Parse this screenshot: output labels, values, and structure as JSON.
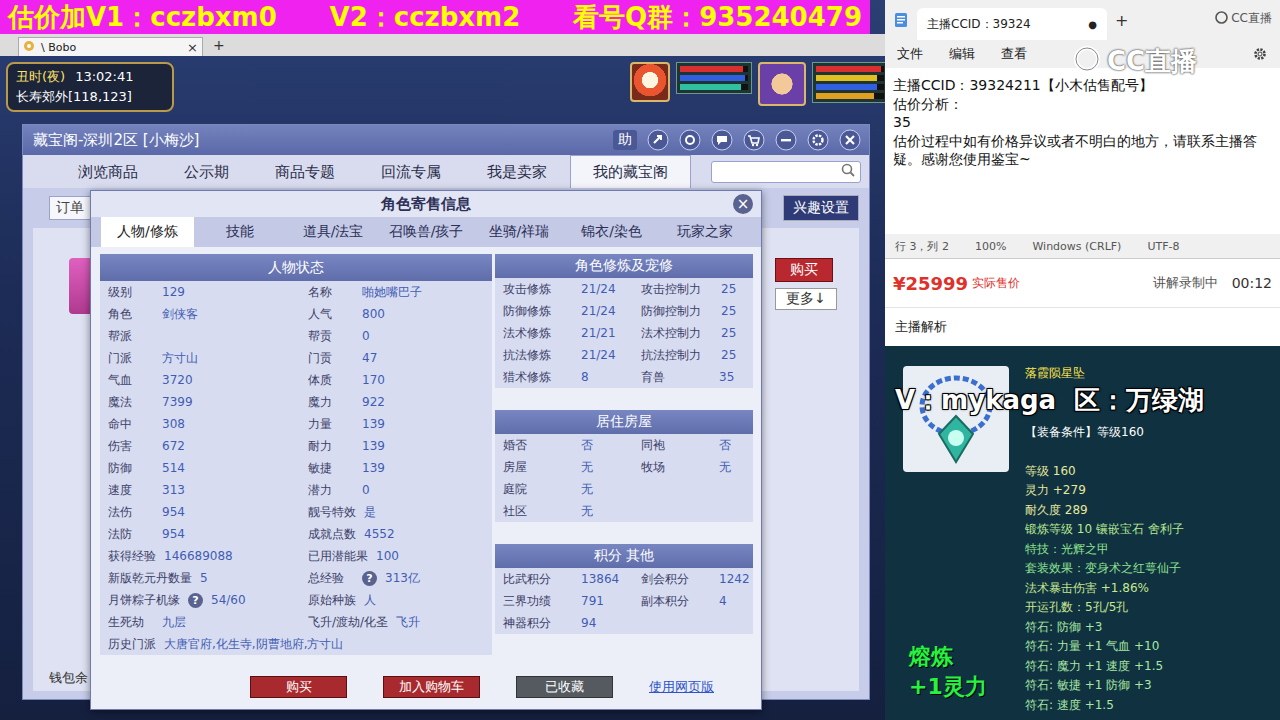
{
  "banner": {
    "parts": [
      "估价加V1：cczbxm0",
      "V2：cczbxm2",
      "看号Q群：935240479"
    ]
  },
  "browser_tab": {
    "label": "\\ Bobo",
    "close": "×",
    "new": "+"
  },
  "hud": {
    "time": "丑时(夜)",
    "clock": "13:02:41",
    "location": "长寿郊外[118,123]",
    "pet_bars": [
      {
        "level": 0.92,
        "color": "#d83030"
      },
      {
        "level": 0.95,
        "color": "#3060e0"
      },
      {
        "level": 0.9,
        "color": "#30c0a0"
      }
    ],
    "player_bars": [
      {
        "level": 0.95,
        "color": "#d83030"
      },
      {
        "level": 0.9,
        "color": "#e0c020"
      },
      {
        "level": 0.9,
        "color": "#3060e0"
      },
      {
        "level": 0.85,
        "color": "#e0a020"
      }
    ]
  },
  "cbg": {
    "title": "藏宝阁-深圳2区 [小梅沙]",
    "help": "助",
    "tabs": [
      {
        "label": "浏览商品",
        "selected": false
      },
      {
        "label": "公示期",
        "selected": false
      },
      {
        "label": "商品专题",
        "selected": false
      },
      {
        "label": "回流专属",
        "selected": false
      },
      {
        "label": "我是卖家",
        "selected": false
      },
      {
        "label": "我的藏宝阁",
        "selected": true
      }
    ],
    "order_label": "订单",
    "interest_button": "兴趣设置",
    "buy_button": "购买",
    "more_button": "更多↓",
    "wallet": "钱包余"
  },
  "dialog": {
    "title": "角色寄售信息",
    "close": "×",
    "tabs": [
      {
        "label": "人物/修炼",
        "selected": true
      },
      {
        "label": "技能",
        "selected": false
      },
      {
        "label": "道具/法宝",
        "selected": false
      },
      {
        "label": "召唤兽/孩子",
        "selected": false
      },
      {
        "label": "坐骑/祥瑞",
        "selected": false
      },
      {
        "label": "锦衣/染色",
        "selected": false
      },
      {
        "label": "玩家之家",
        "selected": false
      }
    ],
    "status_title": "人物状态",
    "status_rows": [
      [
        {
          "label": "级别",
          "value": "129"
        },
        {
          "label": "名称",
          "value": "啪她嘴巴子"
        }
      ],
      [
        {
          "label": "角色",
          "value": "剑侠客"
        },
        {
          "label": "人气",
          "value": "800"
        }
      ],
      [
        {
          "label": "帮派",
          "value": ""
        },
        {
          "label": "帮贡",
          "value": "0"
        }
      ],
      [
        {
          "label": "门派",
          "value": "方寸山"
        },
        {
          "label": "门贡",
          "value": "47"
        }
      ],
      [
        {
          "label": "气血",
          "value": "3720"
        },
        {
          "label": "体质",
          "value": "170"
        }
      ],
      [
        {
          "label": "魔法",
          "value": "7399"
        },
        {
          "label": "魔力",
          "value": "922"
        }
      ],
      [
        {
          "label": "命中",
          "value": "308"
        },
        {
          "label": "力量",
          "value": "139"
        }
      ],
      [
        {
          "label": "伤害",
          "value": "672"
        },
        {
          "label": "耐力",
          "value": "139"
        }
      ],
      [
        {
          "label": "防御",
          "value": "514"
        },
        {
          "label": "敏捷",
          "value": "139"
        }
      ],
      [
        {
          "label": "速度",
          "value": "313"
        },
        {
          "label": "潜力",
          "value": "0"
        }
      ],
      [
        {
          "label": "法伤",
          "value": "954"
        },
        {
          "label": "靓号特效",
          "value": "是"
        }
      ],
      [
        {
          "label": "法防",
          "value": "954"
        },
        {
          "label": "成就点数",
          "value": "4552"
        }
      ],
      [
        {
          "label": "获得经验",
          "value": "146689088"
        },
        {
          "label": "已用潜能果",
          "value": "100"
        }
      ],
      [
        {
          "label": "新版乾元丹数量",
          "value": "5"
        },
        {
          "label": "总经验",
          "help": "?",
          "value": "313亿"
        }
      ],
      [
        {
          "label": "月饼粽子机缘",
          "help": "?",
          "value": "54/60"
        },
        {
          "label": "原始种族",
          "value": "人"
        }
      ],
      [
        {
          "label": "生死劫",
          "value": "九层"
        },
        {
          "label": "飞升/渡劫/化圣",
          "value": "飞升"
        }
      ]
    ],
    "history": {
      "label": "历史门派",
      "value": "大唐官府,化生寺,阴曹地府,方寸山"
    },
    "cultivation_title": "角色修炼及宠修",
    "cultivation_rows": [
      [
        {
          "label": "攻击修炼",
          "value": "21/24"
        },
        {
          "label": "攻击控制力",
          "value": "25"
        }
      ],
      [
        {
          "label": "防御修炼",
          "value": "21/24"
        },
        {
          "label": "防御控制力",
          "value": "25"
        }
      ],
      [
        {
          "label": "法术修炼",
          "value": "21/21"
        },
        {
          "label": "法术控制力",
          "value": "25"
        }
      ],
      [
        {
          "label": "抗法修炼",
          "value": "21/24"
        },
        {
          "label": "抗法控制力",
          "value": "25"
        }
      ],
      [
        {
          "label": "猎术修炼",
          "value": "8"
        },
        {
          "label": "育兽",
          "value": "35"
        }
      ]
    ],
    "house_title": "居住房屋",
    "house_rows": [
      [
        {
          "label": "婚否",
          "value": "否"
        },
        {
          "label": "同袍",
          "value": "否"
        }
      ],
      [
        {
          "label": "房屋",
          "value": "无"
        },
        {
          "label": "牧场",
          "value": "无"
        }
      ],
      [
        {
          "label": "庭院",
          "value": "无"
        }
      ],
      [
        {
          "label": "社区",
          "value": "无"
        }
      ]
    ],
    "score_title": "积分 其他",
    "score_rows": [
      [
        {
          "label": "比武积分",
          "value": "13864"
        },
        {
          "label": "剑会积分",
          "value": "1242"
        }
      ],
      [
        {
          "label": "三界功绩",
          "value": "791"
        },
        {
          "label": "副本积分",
          "value": "4"
        }
      ],
      [
        {
          "label": "神器积分",
          "value": "94"
        }
      ]
    ],
    "buttons": [
      {
        "label": "购买",
        "kind": "red"
      },
      {
        "label": "加入购物车",
        "kind": "red"
      },
      {
        "label": "已收藏",
        "kind": "dark"
      },
      {
        "label": "使用网页版",
        "kind": "link"
      }
    ]
  },
  "notepad": {
    "tab": "主播CCID：39324",
    "tab_dot": "●",
    "new_tab": "+",
    "logo_small": "CC直播",
    "logo_big": "CC直播",
    "menu": [
      "文件",
      "编辑",
      "查看"
    ],
    "lines": [
      "主播CCID：39324211【小木估售配号】",
      "估价分析：",
      "35",
      "估价过程中如有价格异议或者不明白的地方，请联系主播答疑。感谢您使用鉴宝~"
    ],
    "status": [
      "行 3，列 2",
      "100%",
      "Windows (CRLF)",
      "UTF-8"
    ]
  },
  "sale": {
    "price": "¥25999",
    "price_label": "实际售价",
    "recording": "讲解录制中",
    "timer": "00:12",
    "analysis": "主播解析"
  },
  "item": {
    "name": "落霞陨星坠",
    "watermark": "V：mykaga  区：万绿湖",
    "requirement": "【装备条件】等级160",
    "lines": [
      {
        "text": "等级 160",
        "color": "#e6e89c"
      },
      {
        "text": "灵力 +279",
        "color": "#e6e89c"
      },
      {
        "text": "耐久度 289",
        "color": "#e6e89c"
      },
      {
        "text": "锻炼等级 10 镶嵌宝石 舍利子",
        "color": "#b8e890"
      },
      {
        "text": "特技：光辉之甲",
        "color": "#8fe38f"
      },
      {
        "text": "套装效果：变身术之红萼仙子",
        "color": "#8fe38f"
      },
      {
        "text": "法术暴击伤害 +1.86%",
        "color": "#c8e890"
      },
      {
        "text": "开运孔数：5孔/5孔",
        "color": "#c8e890"
      },
      {
        "text": "符石: 防御 +3",
        "color": "#a8e8a0"
      },
      {
        "text": "符石: 力量 +1 气血 +10",
        "color": "#a8e8a0"
      },
      {
        "text": "符石: 魔力 +1 速度 +1.5",
        "color": "#a8e8a0"
      },
      {
        "text": "符石: 敏捷 +1 防御 +3",
        "color": "#a8e8a0"
      },
      {
        "text": "符石: 速度 +1.5",
        "color": "#a8e8a0"
      }
    ],
    "melt": [
      "熔炼",
      "+1灵力"
    ]
  }
}
